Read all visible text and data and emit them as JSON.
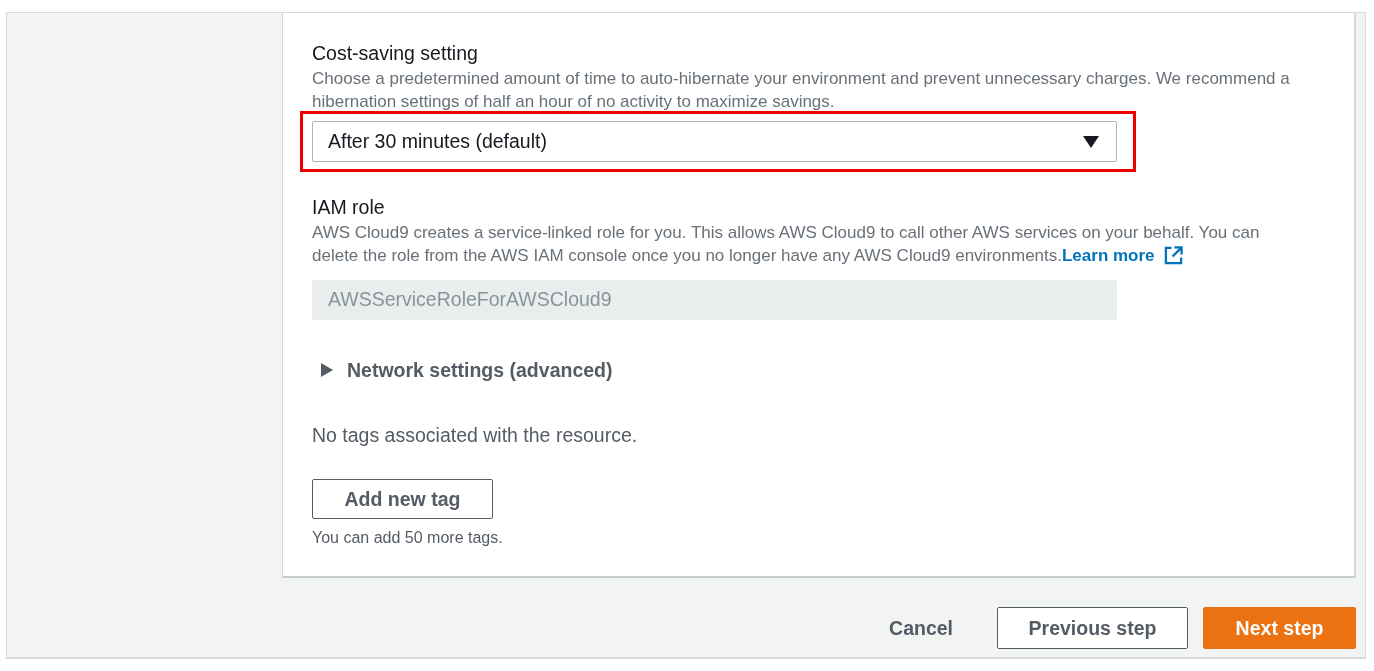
{
  "cost_saving": {
    "label": "Cost-saving setting",
    "description": "Choose a predetermined amount of time to auto-hibernate your environment and prevent unnecessary charges. We recommend a hibernation settings of half an hour of no activity to maximize savings.",
    "value": "After 30 minutes (default)",
    "highlighted": true
  },
  "iam_role": {
    "label": "IAM role",
    "description": "AWS Cloud9 creates a service-linked role for you. This allows AWS Cloud9 to call other AWS services on your behalf. You can delete the role from the AWS IAM console once you no longer have any AWS Cloud9 environments.",
    "link": "Learn more",
    "value": "AWSServiceRoleForAWSCloud9",
    "disabled": true
  },
  "network_settings": {
    "label": "Network settings (advanced)",
    "expanded": false
  },
  "tags": {
    "empty_message": "No tags associated with the resource.",
    "add_button": "Add new tag",
    "hint": "You can add 50 more tags."
  },
  "footer": {
    "buttons": [
      {
        "label": "Cancel",
        "kind": "link"
      },
      {
        "label": "Previous step",
        "kind": "secondary"
      },
      {
        "label": "Next step",
        "kind": "primary"
      }
    ]
  }
}
